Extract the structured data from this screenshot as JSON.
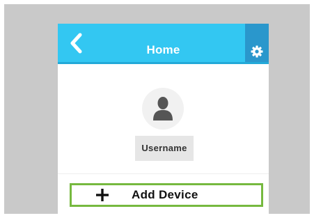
{
  "header": {
    "title": "Home",
    "back_icon": "chevron-left-icon",
    "settings_icon": "gear-icon"
  },
  "profile": {
    "avatar_icon": "user-icon",
    "username": "Username"
  },
  "actions": {
    "add_device_icon": "plus-icon",
    "add_device_label": "Add Device"
  },
  "colors": {
    "header_bg": "#33c7f2",
    "settings_bg": "#2a97cc",
    "highlight_border": "#76b93f",
    "backdrop": "#c9c9c9"
  }
}
